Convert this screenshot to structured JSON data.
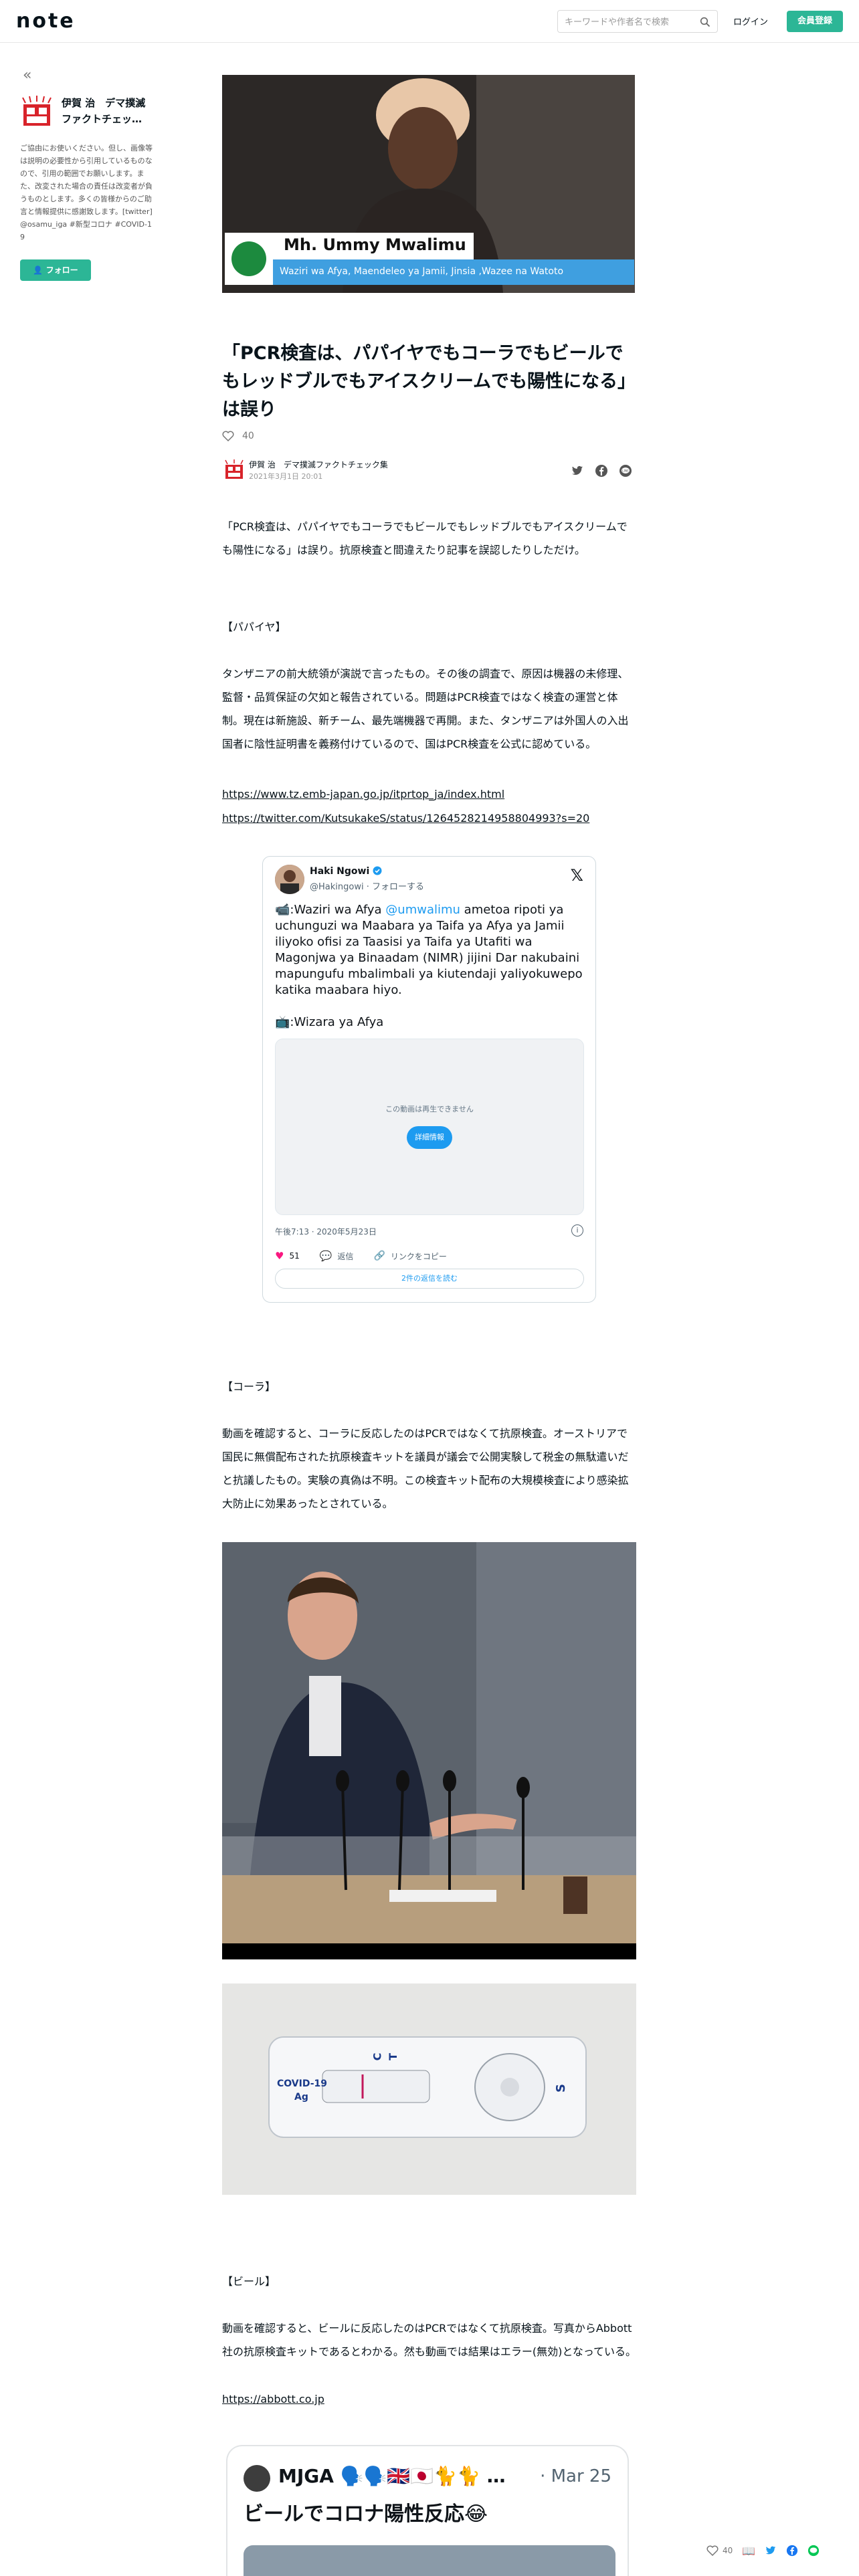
{
  "header": {
    "logo": "note",
    "search_placeholder": "キーワードや作者名で検索",
    "login_label": "ログイン",
    "register_label": "会員登録"
  },
  "sidebar": {
    "collapse_glyph": "«",
    "creator_name": "伊賀 治　デマ撲滅ファクトチェッ…",
    "bio": "ご協由にお使いください。但し、画像等は説明の必要性から引用しているものなので、引用の範囲でお願いします。また、改変された場合の責任は改変者が負うものとします。多くの皆様からのご助言と情報提供に感謝致します。[twitter]@osamu_iga #新型コロナ #COVID-19",
    "follow_label": "フォロー"
  },
  "hero": {
    "name_caption": "Mh. Ummy Mwalimu",
    "role_caption": "Waziri wa Afya, Maendeleo ya Jamii, Jinsia ,Wazee na Watoto"
  },
  "article": {
    "title": "「PCR検査は、パパイヤでもコーラでもビールでもレッドブルでもアイスクリームでも陽性になる」は誤り",
    "like_count": "40",
    "author": "伊賀 治　デマ撲滅ファクトチェック集",
    "date": "2021年3月1日 20:01",
    "intro": "「PCR検査は、パパイヤでもコーラでもビールでもレッドブルでもアイスクリームでも陽性になる」は誤り。抗原検査と間違えたり記事を誤認したりしただけ。",
    "h_papaya": "【パパイヤ】",
    "p_papaya": "タンザニアの前大統領が演説で言ったもの。その後の調査で、原因は機器の未修理、監督・品質保証の欠如と報告されている。問題はPCR検査ではなく検査の運営と体制。現在は新施設、新チーム、最先端機器で再開。また、タンザニアは外国人の入出国者に陰性証明書を義務付けているので、国はPCR検査を公式に認めている。",
    "link1": "https://www.tz.emb-japan.go.jp/itprtop_ja/index.html",
    "link2": "https://twitter.com/KutsukakeS/status/1264528214958804993?s=20",
    "h_cola": "【コーラ】",
    "p_cola": "動画を確認すると、コーラに反応したのはPCRではなくて抗原検査。オーストリアで国民に無償配布された抗原検査キットを議員が議会で公開実験して税金の無駄遣いだと抗議したもの。実験の真偽は不明。この検査キット配布の大規模検査により感染拡大防止に効果あったとされている。",
    "kit_label_1": "COVID-19",
    "kit_label_2": "Ag",
    "kit_c": "C",
    "kit_t": "T",
    "kit_s": "S",
    "h_beer": "【ビール】",
    "p_beer": "動画を確認すると、ビールに反応したのはPCRではなくて抗原検査。写真からAbbott社の抗原検査キットであるとわかる。然も動画では結果はエラー(無効)となっている。",
    "link3": "https://abbott.co.jp"
  },
  "tweet": {
    "name": "Haki Ngowi",
    "handle": "@Hakingowi · フォローする",
    "text_pre": "📹:Waziri wa Afya ",
    "mention": "@umwalimu",
    "text_post": " ametoa ripoti ya uchunguzi wa Maabara ya Taifa ya Afya ya Jamii iliyoko ofisi za Taasisi ya Taifa ya Utafiti wa Magonjwa ya Binaadam (NIMR) jijini Dar nakubaini mapungufu mbalimbali ya kiutendaji yaliyokuwepo katika maabara hiyo.",
    "text_line2": "📺:Wizara ya Afya",
    "media_message": "この動画は再生できません",
    "media_button": "詳細情報",
    "time": "午後7:13 · 2020年5月23日",
    "likes": "51",
    "reply": "返信",
    "copy": "リンクをコピー",
    "more": "2件の返信を読む"
  },
  "quote": {
    "name": "MJGA 🗣️🗣️🇬🇧🇯🇵🐈🐈 …",
    "date": "· Mar 25",
    "text": "ビールでコロナ陽性反応😂"
  },
  "floatbar": {
    "likes": "40"
  },
  "colors": {
    "brand_green": "#2cb696",
    "like_red": "#f91880",
    "twitter_blue": "#1d9bf0"
  }
}
